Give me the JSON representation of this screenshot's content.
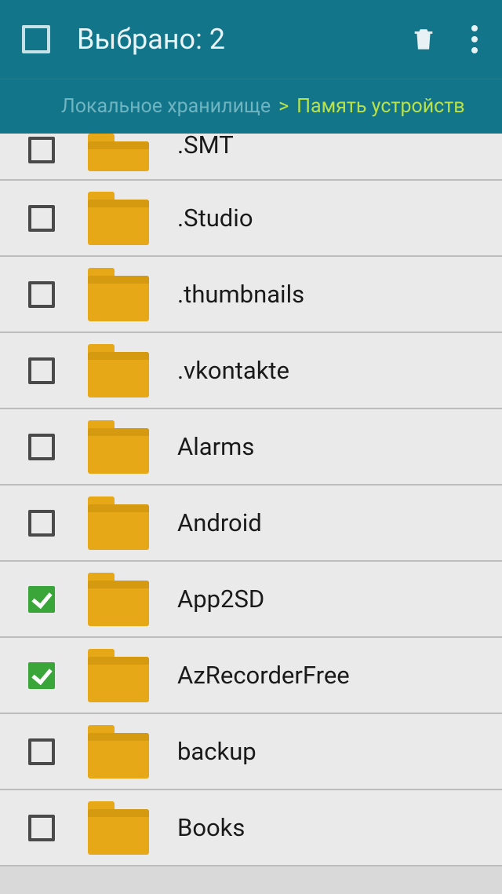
{
  "header": {
    "title": "Выбрано: 2"
  },
  "breadcrumb": {
    "root": "Локальное хранилище",
    "separator": ">",
    "current": "Память устройств"
  },
  "items": [
    {
      "name": ".SMT",
      "checked": false,
      "partial": true
    },
    {
      "name": ".Studio",
      "checked": false
    },
    {
      "name": ".thumbnails",
      "checked": false
    },
    {
      "name": ".vkontakte",
      "checked": false
    },
    {
      "name": "Alarms",
      "checked": false
    },
    {
      "name": "Android",
      "checked": false
    },
    {
      "name": "App2SD",
      "checked": true
    },
    {
      "name": "AzRecorderFree",
      "checked": true
    },
    {
      "name": "backup",
      "checked": false
    },
    {
      "name": "Books",
      "checked": false
    }
  ]
}
